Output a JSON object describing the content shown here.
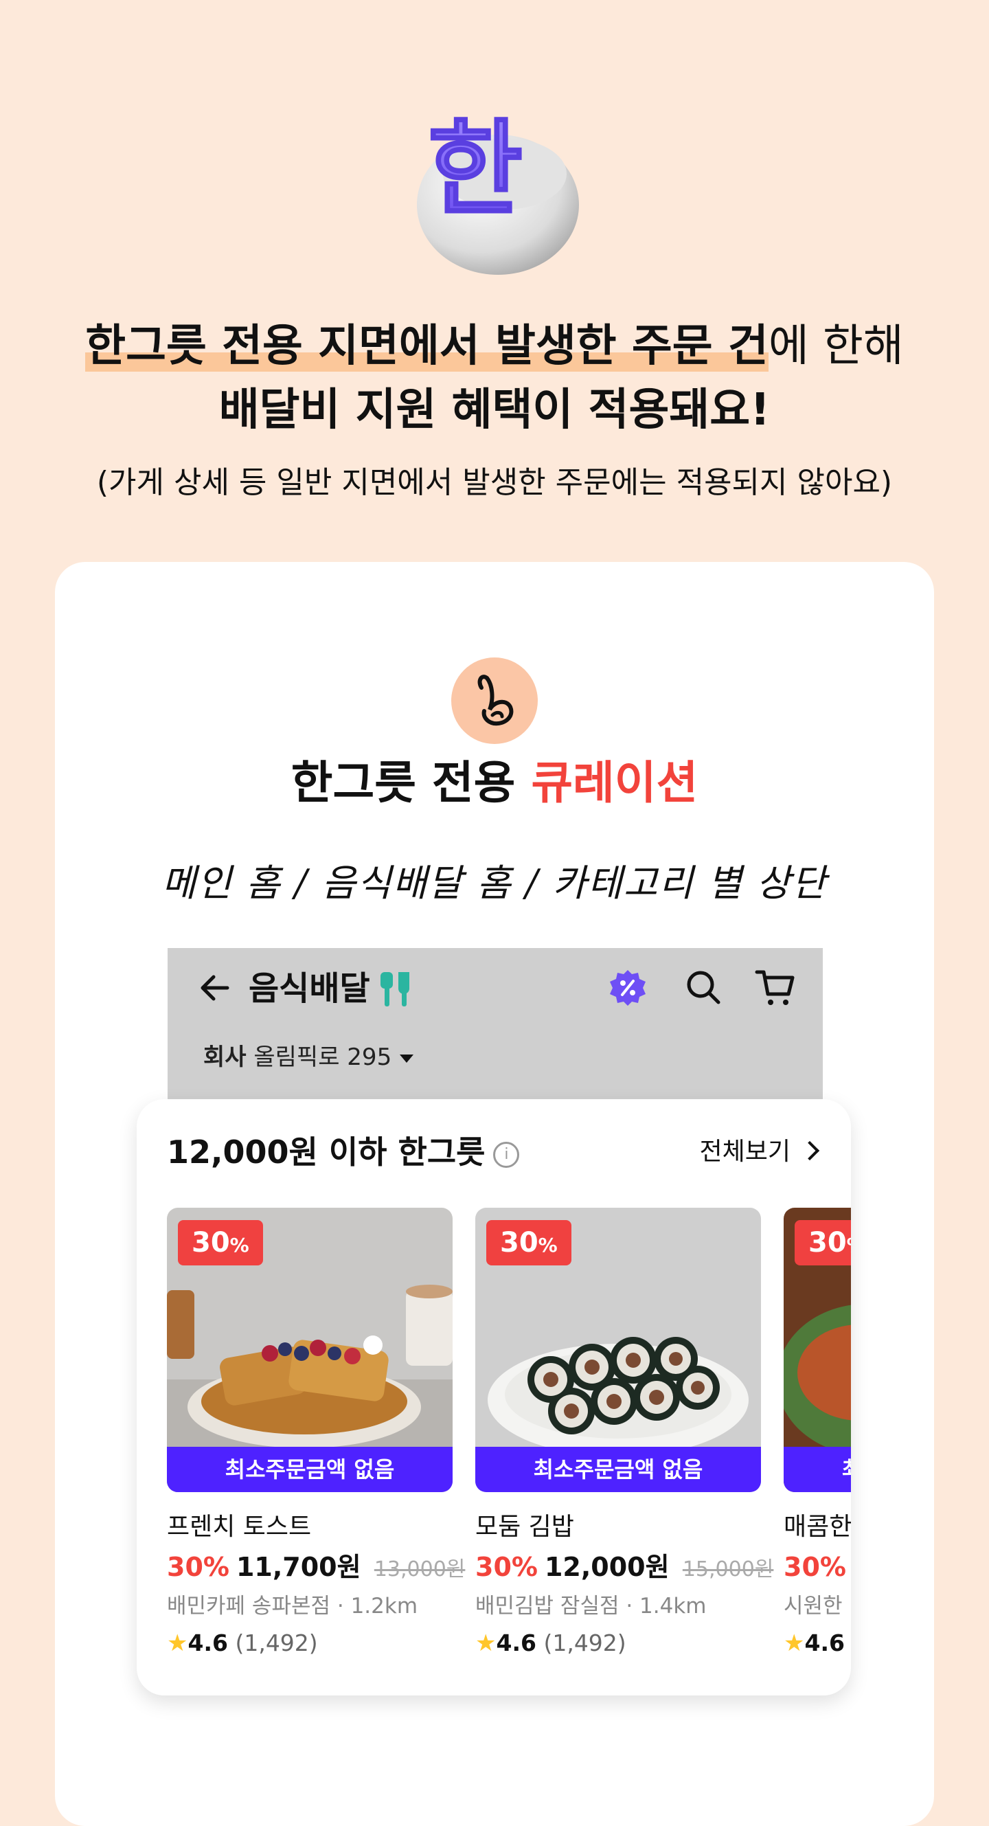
{
  "notice": {
    "line1_highlight": "한그릇 전용 지면에서 발생한 주문 건",
    "line1_rest": "에 한해",
    "line2": "배달비 지원 혜택이 적용돼요!",
    "sub": "(가게 상세 등 일반 지면에서 발생한 주문에는 적용되지 않아요)"
  },
  "logo": {
    "glyph": "한",
    "icon": "hangeureut-bowl-logo"
  },
  "curation": {
    "badge_icon": "b-brand-icon",
    "title_plain": "한그릇 전용 ",
    "title_accent": "큐레이션",
    "placements": "메인 홈 / 음식배달 홈 / 카테고리 별 상단",
    "accent_color": "#f2433b"
  },
  "appbar": {
    "title": "음식배달",
    "address_label": "회사",
    "address_value": "올림픽로 295",
    "icons": [
      "back-arrow-icon",
      "fork-knife-icon",
      "discount-badge-icon",
      "search-icon",
      "cart-icon"
    ]
  },
  "section": {
    "title": "12,000원 이하 한그릇",
    "see_all": "전체보기",
    "items": [
      {
        "discount": "30",
        "percent_sign": "%",
        "min_order": "최소주문금액 없음",
        "name": "프렌치 토스트",
        "pct": "30%",
        "price": "11,700원",
        "orig": "13,000원",
        "store": "배민카페 송파본점 · 1.2km",
        "rating": "4.6",
        "count": "(1,492)"
      },
      {
        "discount": "30",
        "percent_sign": "%",
        "min_order": "최소주문금액 없음",
        "name": "모둠 김밥",
        "pct": "30%",
        "price": "12,000원",
        "orig": "15,000원",
        "store": "배민김밥 잠실점 · 1.4km",
        "rating": "4.6",
        "count": "(1,492)"
      },
      {
        "discount": "30",
        "percent_sign": "%",
        "min_order": "최소주문금액 없음",
        "name": "매콤한",
        "pct": "30%",
        "price": "",
        "orig": "",
        "store": "시원한",
        "rating": "4.6",
        "count": ""
      }
    ]
  },
  "colors": {
    "background": "#fde9da",
    "brand_purple": "#4e22ff",
    "discount_red": "#f04140",
    "highlight": "#fbc79a"
  }
}
